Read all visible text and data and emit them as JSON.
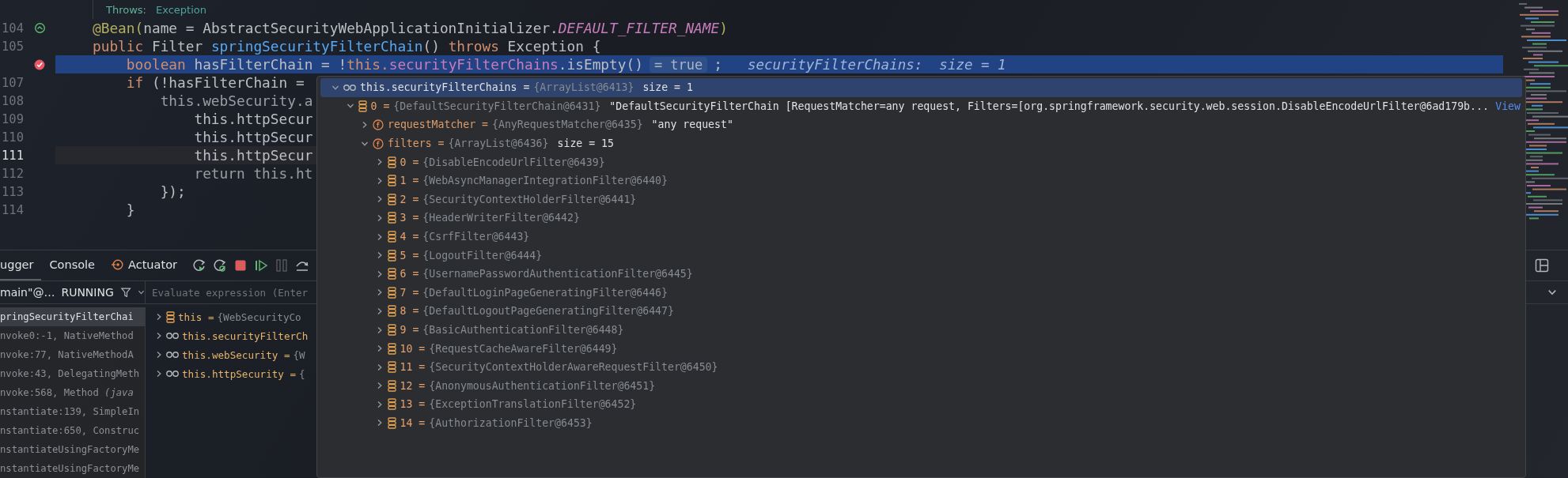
{
  "editor": {
    "doc": {
      "label": "Throws:",
      "value": "Exception"
    },
    "lines": [
      {
        "number": "104",
        "kind": "bean",
        "highlighted": false,
        "current": false,
        "tokens": [
          {
            "kind": "annotation",
            "text": "@Bean("
          },
          {
            "kind": "plain",
            "text": "name = AbstractSecurityWebApplicationInitializer."
          },
          {
            "kind": "constant",
            "text": "DEFAULT_FILTER_NAME"
          },
          {
            "kind": "annotation",
            "text": ")"
          }
        ]
      },
      {
        "number": "105",
        "kind": "plain",
        "highlighted": false,
        "current": false,
        "tokens": [
          {
            "kind": "keyword",
            "text": "public"
          },
          {
            "kind": "plain",
            "text": " Filter "
          },
          {
            "kind": "method",
            "text": "springSecurityFilterChain"
          },
          {
            "kind": "plain",
            "text": "() "
          },
          {
            "kind": "keyword",
            "text": "throws"
          },
          {
            "kind": "plain",
            "text": " Exception {"
          }
        ]
      },
      {
        "kind": "breakpoint",
        "highlighted": true,
        "current": false,
        "tokens": [
          {
            "kind": "keyword",
            "text": "    boolean"
          },
          {
            "kind": "plain",
            "text": " hasFilterChain = !"
          },
          {
            "kind": "keyword",
            "text": "this."
          },
          {
            "kind": "field",
            "text": "securityFilterChains"
          },
          {
            "kind": "plain",
            "text": ".isEmpty()"
          }
        ],
        "inline": [
          {
            "kind": "pill",
            "text": "= true"
          },
          {
            "kind": "plain",
            "text": ";"
          },
          {
            "kind": "hint",
            "text": "securityFilterChains:  size = 1"
          }
        ]
      },
      {
        "number": "107",
        "kind": "plain",
        "highlighted": false,
        "current": false,
        "tokens": [
          {
            "kind": "keyword",
            "text": "    if"
          },
          {
            "kind": "plain",
            "text": " (!hasFilterChain ="
          }
        ]
      },
      {
        "number": "108",
        "kind": "plain",
        "highlighted": false,
        "current": false,
        "tokens": [
          {
            "kind": "dim",
            "text": "        this.webSecurity.a"
          }
        ]
      },
      {
        "number": "109",
        "kind": "plain",
        "highlighted": false,
        "current": false,
        "tokens": [
          {
            "kind": "plain",
            "text": "            this.httpSecur"
          }
        ]
      },
      {
        "number": "110",
        "kind": "plain",
        "highlighted": false,
        "current": false,
        "tokens": [
          {
            "kind": "plain",
            "text": "            this.httpSecur"
          }
        ]
      },
      {
        "number": "111",
        "kind": "plain",
        "highlighted": false,
        "current": true,
        "tokens": [
          {
            "kind": "plain",
            "text": "            this.httpSecur"
          }
        ]
      },
      {
        "number": "112",
        "kind": "plain",
        "highlighted": false,
        "current": false,
        "tokens": [
          {
            "kind": "dim",
            "text": "            return this.ht"
          }
        ]
      },
      {
        "number": "113",
        "kind": "plain",
        "highlighted": false,
        "current": false,
        "tokens": [
          {
            "kind": "plain",
            "text": "        });"
          }
        ]
      },
      {
        "number": "114",
        "kind": "plain",
        "highlighted": false,
        "current": false,
        "tokens": [
          {
            "kind": "plain",
            "text": "    }"
          }
        ]
      }
    ]
  },
  "evaluation_popup": {
    "rows": [
      {
        "kind": "watch",
        "selected": true,
        "expanded": true,
        "name": "this.securityFilterChains =",
        "value": "{ArrayList@6413}",
        "extra": "size = 1",
        "children": [
          {
            "kind": "item",
            "selected": false,
            "expanded": true,
            "name": "0 =",
            "value": "{DefaultSecurityFilterChain@6431}",
            "extra": "\"DefaultSecurityFilterChain [RequestMatcher=any request, Filters=[org.springframework.security.web.session.DisableEncodeUrlFilter@6ad179b...",
            "link": "View",
            "children": [
              {
                "kind": "field",
                "selected": false,
                "expanded": false,
                "name": "requestMatcher =",
                "value": "{AnyRequestMatcher@6435}",
                "extra": "\"any request\""
              },
              {
                "kind": "field",
                "selected": false,
                "expanded": true,
                "name": "filters =",
                "value": "{ArrayList@6436}",
                "extra": "size = 15",
                "children": [
                  {
                    "kind": "item",
                    "selected": false,
                    "expanded": false,
                    "name": "0 =",
                    "value": "{DisableEncodeUrlFilter@6439}"
                  },
                  {
                    "kind": "item",
                    "selected": false,
                    "expanded": false,
                    "name": "1 =",
                    "value": "{WebAsyncManagerIntegrationFilter@6440}"
                  },
                  {
                    "kind": "item",
                    "selected": false,
                    "expanded": false,
                    "name": "2 =",
                    "value": "{SecurityContextHolderFilter@6441}"
                  },
                  {
                    "kind": "item",
                    "selected": false,
                    "expanded": false,
                    "name": "3 =",
                    "value": "{HeaderWriterFilter@6442}"
                  },
                  {
                    "kind": "item",
                    "selected": false,
                    "expanded": false,
                    "name": "4 =",
                    "value": "{CsrfFilter@6443}"
                  },
                  {
                    "kind": "item",
                    "selected": false,
                    "expanded": false,
                    "name": "5 =",
                    "value": "{LogoutFilter@6444}"
                  },
                  {
                    "kind": "item",
                    "selected": false,
                    "expanded": false,
                    "name": "6 =",
                    "value": "{UsernamePasswordAuthenticationFilter@6445}"
                  },
                  {
                    "kind": "item",
                    "selected": false,
                    "expanded": false,
                    "name": "7 =",
                    "value": "{DefaultLoginPageGeneratingFilter@6446}"
                  },
                  {
                    "kind": "item",
                    "selected": false,
                    "expanded": false,
                    "name": "8 =",
                    "value": "{DefaultLogoutPageGeneratingFilter@6447}"
                  },
                  {
                    "kind": "item",
                    "selected": false,
                    "expanded": false,
                    "name": "9 =",
                    "value": "{BasicAuthenticationFilter@6448}"
                  },
                  {
                    "kind": "item",
                    "selected": false,
                    "expanded": false,
                    "name": "10 =",
                    "value": "{RequestCacheAwareFilter@6449}"
                  },
                  {
                    "kind": "item",
                    "selected": false,
                    "expanded": false,
                    "name": "11 =",
                    "value": "{SecurityContextHolderAwareRequestFilter@6450}"
                  },
                  {
                    "kind": "item",
                    "selected": false,
                    "expanded": false,
                    "name": "12 =",
                    "value": "{AnonymousAuthenticationFilter@6451}"
                  },
                  {
                    "kind": "item",
                    "selected": false,
                    "expanded": false,
                    "name": "13 =",
                    "value": "{ExceptionTranslationFilter@6452}"
                  },
                  {
                    "kind": "item",
                    "selected": false,
                    "expanded": false,
                    "name": "14 =",
                    "value": "{AuthorizationFilter@6453}"
                  }
                ]
              }
            ]
          }
        ]
      }
    ]
  },
  "debugger": {
    "tabs": [
      {
        "kind": "plain",
        "label": "ugger",
        "selected": true
      },
      {
        "kind": "plain",
        "label": "Console",
        "selected": false
      },
      {
        "kind": "actuator",
        "label": "Actuator",
        "selected": false
      }
    ],
    "thread": {
      "name": "main\"@…",
      "state": "RUNNING"
    },
    "evaluate": {
      "placeholder": "Evaluate expression (Enter"
    },
    "frames": [
      {
        "text": "pringSecurityFilterChai",
        "selected": true
      },
      {
        "text": "nvoke0:-1, NativeMethod",
        "selected": false
      },
      {
        "text": "nvoke:77, NativeMethodA",
        "selected": false
      },
      {
        "text": "nvoke:43, DelegatingMeth",
        "selected": false
      },
      {
        "text": "nvoke:568, Method *(java*",
        "selected": false
      },
      {
        "text": "nstantiate:139, SimpleIn",
        "selected": false
      },
      {
        "text": "nstantiate:650, Construc",
        "selected": false
      },
      {
        "text": "nstantiateUsingFactoryMe",
        "selected": false
      },
      {
        "text": "nstantiateUsingFactoryMe",
        "selected": false
      }
    ],
    "variables": [
      {
        "kind": "item",
        "name": "this =",
        "value": "{WebSecurityCo"
      },
      {
        "kind": "watch",
        "name": "this.securityFilterCh"
      },
      {
        "kind": "watch",
        "name": "this.webSecurity =",
        "value": "{W"
      },
      {
        "kind": "watch",
        "name": "this.httpSecurity =",
        "value": "{"
      }
    ]
  }
}
